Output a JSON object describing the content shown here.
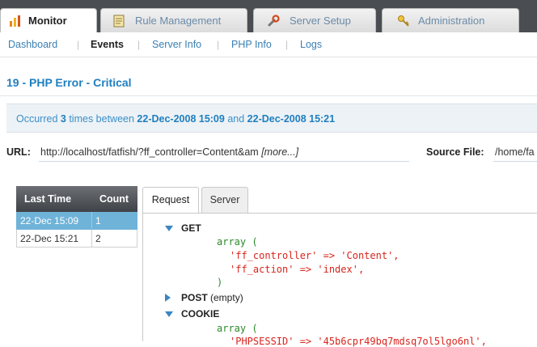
{
  "tabs": [
    {
      "label": "Monitor",
      "icon": "bar-chart-icon",
      "active": true
    },
    {
      "label": "Rule Management",
      "icon": "rules-document-icon",
      "active": false
    },
    {
      "label": "Server Setup",
      "icon": "wrench-icon",
      "active": false
    },
    {
      "label": "Administration",
      "icon": "key-icon",
      "active": false
    }
  ],
  "subnav": {
    "items": [
      "Dashboard",
      "Events",
      "Server Info",
      "PHP Info",
      "Logs"
    ],
    "current": "Events"
  },
  "event": {
    "title": "19 - PHP Error - Critical",
    "occurred_prefix": "Occurred",
    "occurred_count": "3",
    "occurred_mid": "times between",
    "occurred_from": "22-Dec-2008 15:09",
    "occurred_and": "and",
    "occurred_to": "22-Dec-2008 15:21",
    "url_label": "URL:",
    "url_value": "http://localhost/fatfish/?ff_controller=Content&am",
    "url_more": "[more...]",
    "source_label": "Source File:",
    "source_value": "/home/fa"
  },
  "occurrences": {
    "headers": [
      "Last Time",
      "Count"
    ],
    "rows": [
      {
        "time": "22-Dec 15:09",
        "count": "1",
        "selected": true
      },
      {
        "time": "22-Dec 15:21",
        "count": "2",
        "selected": false
      }
    ]
  },
  "detail_tabs": [
    {
      "label": "Request",
      "active": true
    },
    {
      "label": "Server",
      "active": false
    }
  ],
  "request": {
    "get_label": "GET",
    "get_lines": [
      {
        "text": "array (",
        "color": "green"
      },
      {
        "text": "'ff_controller' => 'Content',",
        "color": "red"
      },
      {
        "text": "'ff_action' => 'index',",
        "color": "red"
      },
      {
        "text": ")",
        "color": "green"
      }
    ],
    "post_label": "POST",
    "post_note": "(empty)",
    "cookie_label": "COOKIE",
    "cookie_lines": [
      {
        "text": "array (",
        "color": "green"
      },
      {
        "text": "'PHPSESSID' => '45b6cpr49bq7mdsq7ol5lgo6nl',",
        "color": "red"
      }
    ]
  },
  "colors": {
    "accent": "#1f7fbf",
    "selected_row": "#6fb3d8",
    "code_green": "#2a8a2a",
    "code_red": "#d9241c"
  }
}
